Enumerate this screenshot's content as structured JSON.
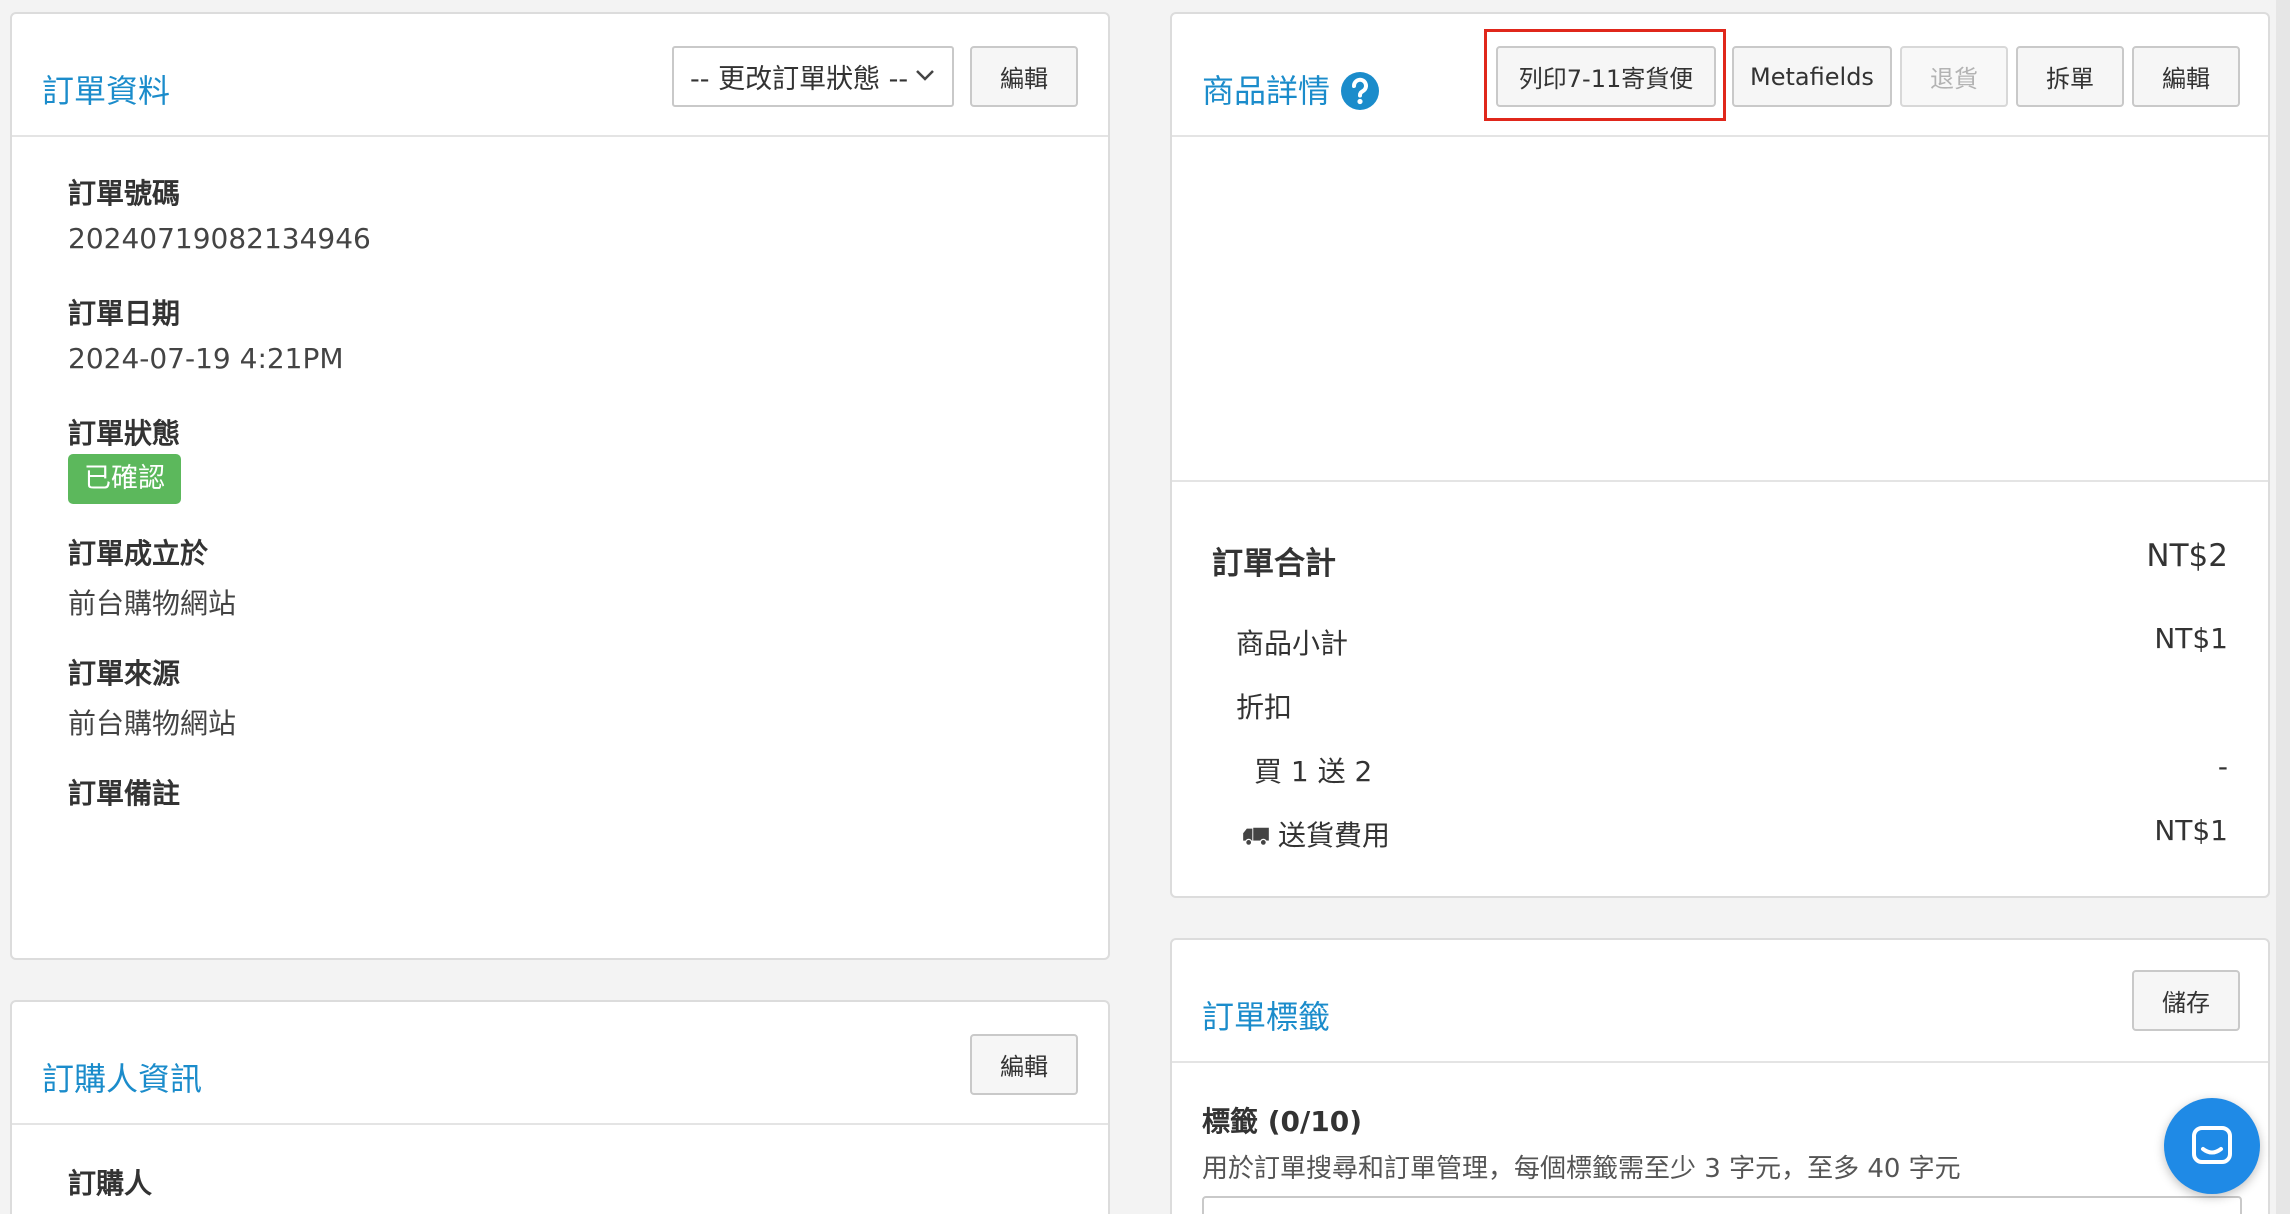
{
  "order_info": {
    "title": "訂單資料",
    "status_select": "-- 更改訂單狀態 --",
    "edit_label": "編輯",
    "fields": {
      "order_number_label": "訂單號碼",
      "order_number": "20240719082134946",
      "order_date_label": "訂單日期",
      "order_date": "2024-07-19 4:21PM",
      "order_status_label": "訂單狀態",
      "order_status": "已確認",
      "created_at_label": "訂單成立於",
      "created_at": "前台購物網站",
      "source_label": "訂單來源",
      "source": "前台購物網站",
      "notes_label": "訂單備註"
    }
  },
  "buyer_info": {
    "title": "訂購人資訊",
    "edit_label": "編輯",
    "buyer_label": "訂購人"
  },
  "product_details": {
    "title": "商品詳情",
    "buttons": {
      "print_711": "列印7-11寄貨便",
      "metafields": "Metafields",
      "return": "退貨",
      "split": "拆單",
      "edit": "編輯"
    },
    "totals": {
      "title": "訂單合計",
      "total": "NT$2",
      "subtotal_label": "商品小計",
      "subtotal": "NT$1",
      "discount_label": "折扣",
      "promo_label": "買 1 送 2",
      "promo_value": "-",
      "shipping_label": "送貨費用",
      "shipping": "NT$1"
    }
  },
  "order_tags": {
    "title": "訂單標籤",
    "save_label": "儲存",
    "tags_label": "標籤 (0/10)",
    "help_text": "用於訂單搜尋和訂單管理，每個標籤需至少 3 字元，至多 40 字元"
  },
  "icons": {
    "help": "question-circle-icon",
    "truck": "truck-icon",
    "chat": "chat-icon",
    "chevron": "chevron-down-icon"
  },
  "colors": {
    "accent": "#1b8ccb",
    "success": "#5cb85c",
    "highlight": "#e0271b",
    "chat": "#1f8ae6"
  }
}
